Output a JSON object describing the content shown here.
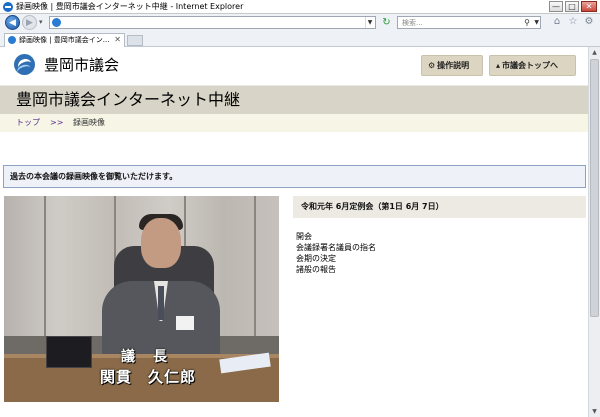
{
  "window": {
    "title": "録画映像 | 豊岡市議会インターネット中継 - Internet Explorer",
    "controls": {
      "minimize": "—",
      "maximize": "□",
      "close": "✕"
    }
  },
  "browser": {
    "search_placeholder": "検索...",
    "tab_label": "録画映像 | 豊岡市議会イン...",
    "tab_close": "✕",
    "icons": [
      "back-arrow-icon",
      "forward-arrow-icon",
      "refresh-icon",
      "search-icon",
      "home-icon",
      "star-icon",
      "gear-icon"
    ]
  },
  "site": {
    "name": "豊岡市議会",
    "buttons": {
      "help": "操作説明",
      "top": "市議会トップへ"
    },
    "page_title": "豊岡市議会インターネット中継",
    "breadcrumb": {
      "home": "トップ",
      "separator": ">>",
      "current": "録画映像"
    },
    "notice": "過去の本会議の録画映像を御覧いただけます。"
  },
  "video": {
    "caption_title": "議　長",
    "caption_name": "関貫　久仁郎"
  },
  "session": {
    "title": "令和元年 6月定例会（第1日 6月 7日）",
    "agenda": [
      "開会",
      "会議録署名議員の指名",
      "会期の決定",
      "諸般の報告"
    ]
  },
  "colors": {
    "banner_bg": "#d8d4c7",
    "breadcrumb_bg": "#f6f5e6",
    "header_button_bg": "#dcd5c2",
    "notice_border": "#8ea3c4",
    "link_color": "#5a2c8f"
  }
}
